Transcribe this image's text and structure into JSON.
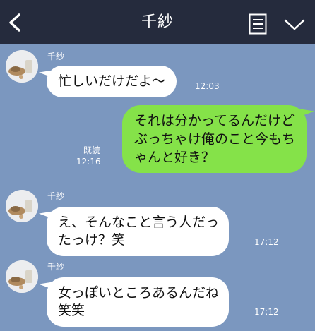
{
  "header": {
    "title": "千紗",
    "back_icon": "chevron-left-icon",
    "note_icon": "notes-icon",
    "menu_icon": "chevron-down-icon",
    "background": "#252b3d"
  },
  "chat": {
    "background": "#7b97bf",
    "incoming_bubble_color": "#ffffff",
    "outgoing_bubble_color": "#85e249",
    "messages": [
      {
        "direction": "incoming",
        "sender": "千紗",
        "lines": [
          "忙しいだけだよ〜"
        ],
        "time": "12:03"
      },
      {
        "direction": "outgoing",
        "lines": [
          "それは分かってるんだけど",
          "ぶっちゃけ俺のこと今もち",
          "ゃんと好き？"
        ],
        "read": "既読",
        "time": "12:16"
      },
      {
        "direction": "incoming",
        "sender": "千紗",
        "lines": [
          "え、そんなこと言う人だっ",
          "たっけ？笑"
        ],
        "time": "17:12"
      },
      {
        "direction": "incoming",
        "sender": "千紗",
        "lines": [
          "女っぽいところあるんだね",
          "笑笑"
        ],
        "time": "17:12"
      }
    ]
  }
}
